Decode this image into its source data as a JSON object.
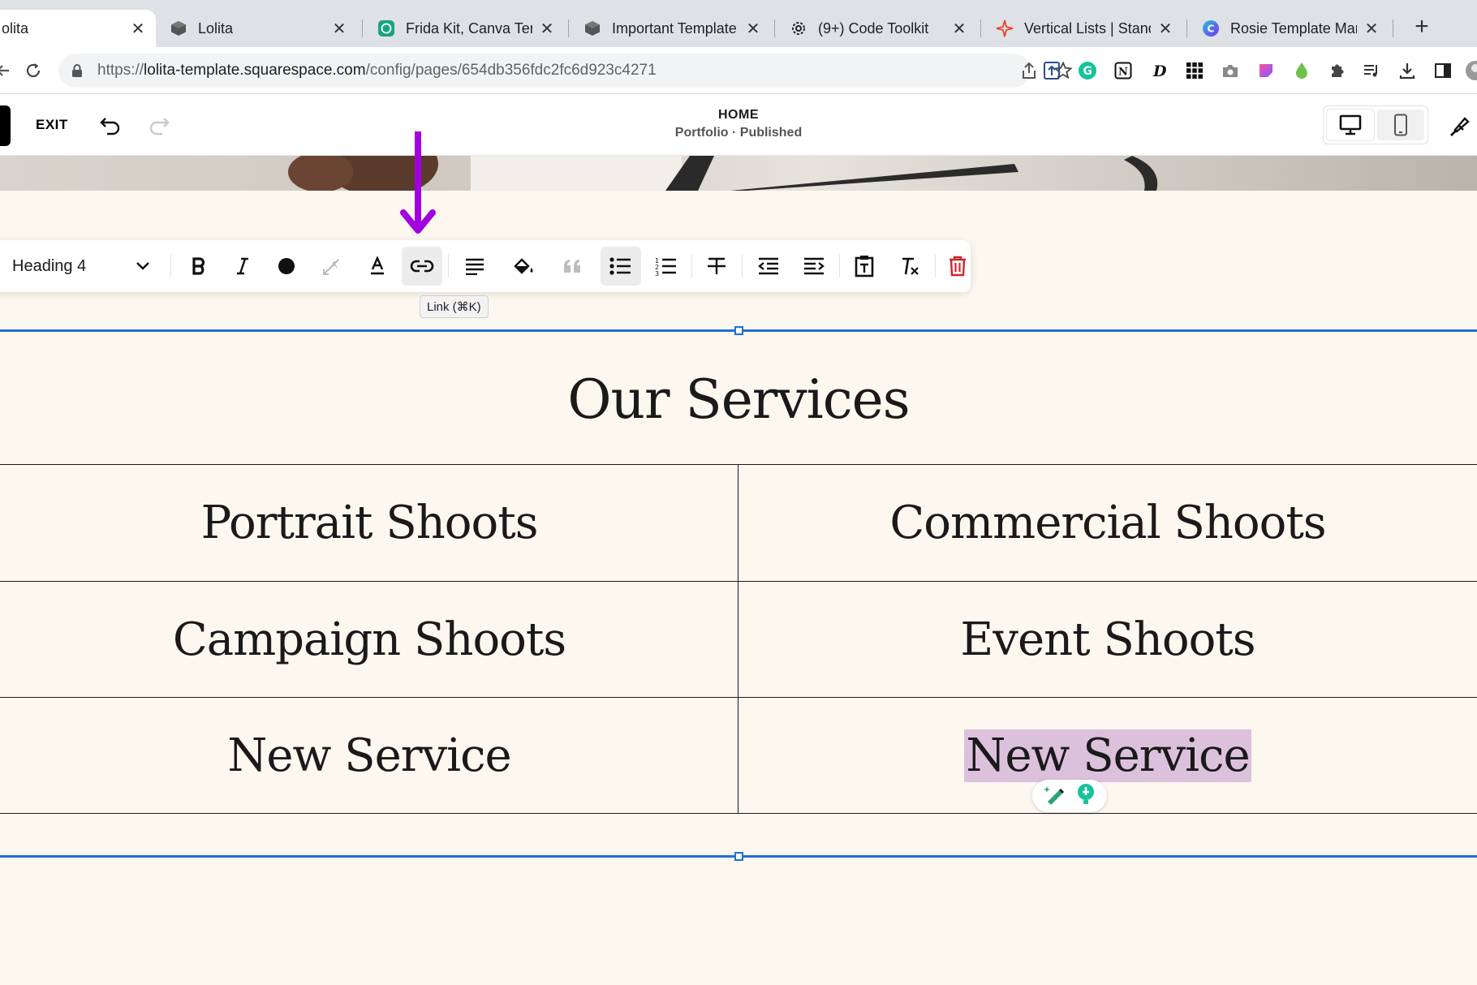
{
  "browser": {
    "tabs": [
      {
        "label": "olita",
        "icon": "squarespace-icon",
        "active": true
      },
      {
        "label": "Lolita",
        "icon": "cube-icon"
      },
      {
        "label": "Frida Kit, Canva Tem",
        "icon": "chatgpt-icon"
      },
      {
        "label": "Important Template I",
        "icon": "cube-icon"
      },
      {
        "label": "(9+) Code Toolkit",
        "icon": "gear-icon"
      },
      {
        "label": "Vertical Lists | Stand",
        "icon": "sparkle-icon"
      },
      {
        "label": "Rosie Template Mark",
        "icon": "canva-icon"
      }
    ],
    "url_prefix": "https://",
    "url_host": "lolita-template.squarespace.com",
    "url_path": "/config/pages/654db356fdc2fc6d923c4271"
  },
  "editor": {
    "exit_label": "EXIT",
    "page_title": "HOME",
    "page_subtitle": "Portfolio · Published"
  },
  "toolbar": {
    "format_label": "Heading 4",
    "tooltip": "Link (⌘K)"
  },
  "content": {
    "title": "Our Services",
    "services": [
      "Portrait Shoots",
      "Commercial Shoots",
      "Campaign Shoots",
      "Event Shoots",
      "New Service",
      "New Service"
    ]
  },
  "colors": {
    "accent_blue": "#1f6fd6",
    "selection_highlight": "#dcc1dc",
    "annotation_arrow": "#a100e0",
    "page_background": "#fcf8f0"
  }
}
